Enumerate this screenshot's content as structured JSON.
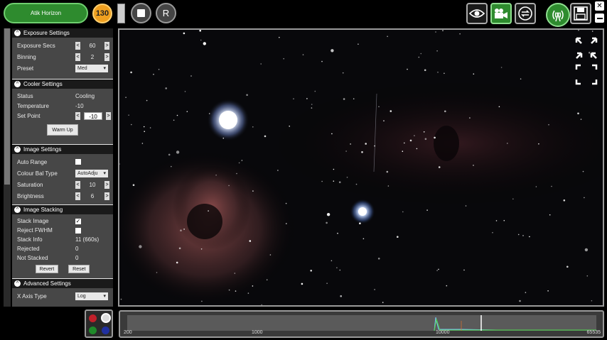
{
  "topbar": {
    "camera_name": "Atik Horizon",
    "exposure_count": "130",
    "r_label": "R",
    "close_glyph": "✕"
  },
  "icons": {
    "view": "eye-icon",
    "video": "video-camera-icon",
    "loop": "loop-icon",
    "wireless": "wireless-icon",
    "save": "save-icon",
    "expand": "expand-icon"
  },
  "colors": {
    "accent_green": "#2e8b2e",
    "counter_orange": "#f0a020",
    "panel_bg": "#474747",
    "header_bg": "#1a1a1a"
  },
  "sections": {
    "exposure": {
      "title": "Exposure Settings",
      "exposure_secs_label": "Exposure Secs",
      "exposure_secs_value": "60",
      "binning_label": "Binning",
      "binning_value": "2",
      "preset_label": "Preset",
      "preset_value": "Med"
    },
    "cooler": {
      "title": "Cooler Settings",
      "status_label": "Status",
      "status_value": "Cooling",
      "temperature_label": "Temperature",
      "temperature_value": "-10",
      "set_point_label": "Set Point",
      "set_point_value": "-10",
      "warm_up_label": "Warm Up"
    },
    "image": {
      "title": "Image Settings",
      "auto_range_label": "Auto Range",
      "auto_range_checked": false,
      "colour_bal_label": "Colour Bal Type",
      "colour_bal_value": "AutoAdju",
      "saturation_label": "Saturation",
      "saturation_value": "10",
      "brightness_label": "Brightness",
      "brightness_value": "6"
    },
    "stacking": {
      "title": "Image Stacking",
      "stack_image_label": "Stack Image",
      "stack_image_checked": true,
      "check_glyph": "✓",
      "reject_fwhm_label": "Reject FWHM",
      "reject_fwhm_checked": false,
      "stack_info_label": "Stack Info",
      "stack_info_value": "11 (660s)",
      "rejected_label": "Rejected",
      "rejected_value": "0",
      "not_stacked_label": "Not Stacked",
      "not_stacked_value": "0",
      "revert_label": "Revert",
      "reset_label": "Reset"
    },
    "advanced": {
      "title": "Advanced Settings",
      "x_axis_type_label": "X Axis Type",
      "x_axis_type_value": "Log"
    }
  },
  "histogram": {
    "ticks": [
      "200",
      "1000",
      "10000",
      "65535"
    ]
  }
}
